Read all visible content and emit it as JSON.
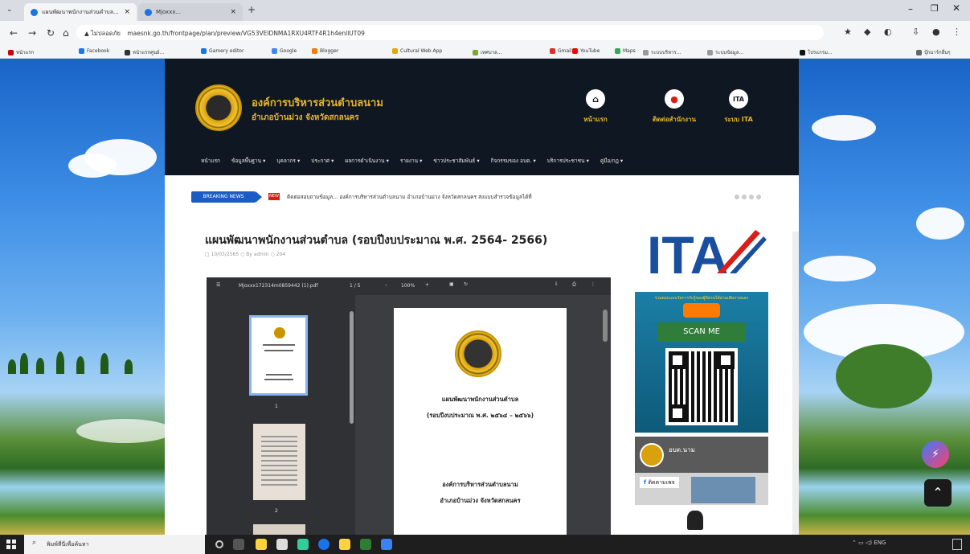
{
  "browser": {
    "tabs": [
      {
        "label": "แผนพัฒนาพนักงานส่วนตำบล...",
        "close": "×"
      },
      {
        "label": "Mjoxxx...",
        "close": "×"
      }
    ],
    "new_tab": "+",
    "url": "maesnk.go.th/frontpage/plan/preview/VG53VEIDNMA1RXU4RTF4R1h4enllUT09",
    "security_label": "ไม่ปลอดภัย",
    "bookmarks": [
      "หน้าแรก",
      "Facebook",
      "หน้าแรกศูนย์...",
      "Gamery editor",
      "Google",
      "Blogger",
      "Cultural Web App",
      "เทศบาล...",
      "Gmail",
      "YouTube",
      "Maps",
      "ระบบบริหาร...",
      "ระบบข้อมูล...",
      "โปรแกรม...",
      "บุ๊กมาร์กอื่นๆ"
    ]
  },
  "site": {
    "title_line1": "องค์การบริหารส่วนตำบลนาม",
    "title_line2": "อำเภอบ้านม่วง จังหวัดสกลนคร",
    "header_icons": [
      {
        "icon": "home-icon",
        "label": "หน้าแรก"
      },
      {
        "icon": "location-icon",
        "label": "ติดต่อสำนักงาน"
      },
      {
        "icon": "ita-icon",
        "label": "ระบบ ITA"
      }
    ],
    "menu": [
      "หน้าแรก",
      "ข้อมูลพื้นฐาน ▾",
      "บุคลากร ▾",
      "ประกาศ ▾",
      "ผลการดำเนินงาน ▾",
      "รายงาน ▾",
      "ข่าวประชาสัมพันธ์ ▾",
      "กิจกรรมของ อบต. ▾",
      "บริการประชาชน ▾",
      "คู่มือ/กฎ ▾"
    ],
    "breaking_label": "BREAKING NEWS",
    "breaking_new": "NEW",
    "breaking_text": "ติดต่อสอบถามข้อมูล... องค์การบริหารส่วนตำบลนาม อำเภอบ้านม่วง จังหวัดสกลนคร ส่งแบบสำรวจข้อมูลได้ที่",
    "post_title": "แผนพัฒนาพนักงานส่วนตำบล (รอบปีงบประมาณ พ.ศ. 2564- 2566)",
    "post_meta": "□ 10/03/2565   ○ By admin   ○ 204"
  },
  "pdf": {
    "filename": "Mjoxxx172314m0859442 (1).pdf",
    "page_indicator": "1 / 5",
    "zoom": "100%",
    "thumb1_num": "1",
    "thumb2_num": "2",
    "doc_title": "แผนพัฒนาพนักงานส่วนตำบล",
    "doc_subtitle": "(รอบปีงบประมาณ พ.ศ. ๒๕๖๔ – ๒๕๖๖)",
    "doc_org1": "องค์การบริหารส่วนตำบลนาม",
    "doc_org2": "อำเภอบ้านม่วง  จังหวัดสกลนคร"
  },
  "sidebar": {
    "ita_text": "ITA",
    "scan_banner": "ร่วมตอบแบบวัดการรับรู้ของผู้มีส่วนได้ส่วนเสียภายนอก",
    "scan_label": "SCAN ME",
    "fb_page": "อบต.นาม",
    "fb_label": "ติดตามเพจ"
  },
  "taskbar": {
    "search_placeholder": "พิมพ์ที่นี่เพื่อค้นหา"
  },
  "colors": {
    "header_bg": "#0f1822",
    "gold": "#e6b52a",
    "breaking_blue": "#1a5bc6",
    "new_red": "#d91e18"
  }
}
